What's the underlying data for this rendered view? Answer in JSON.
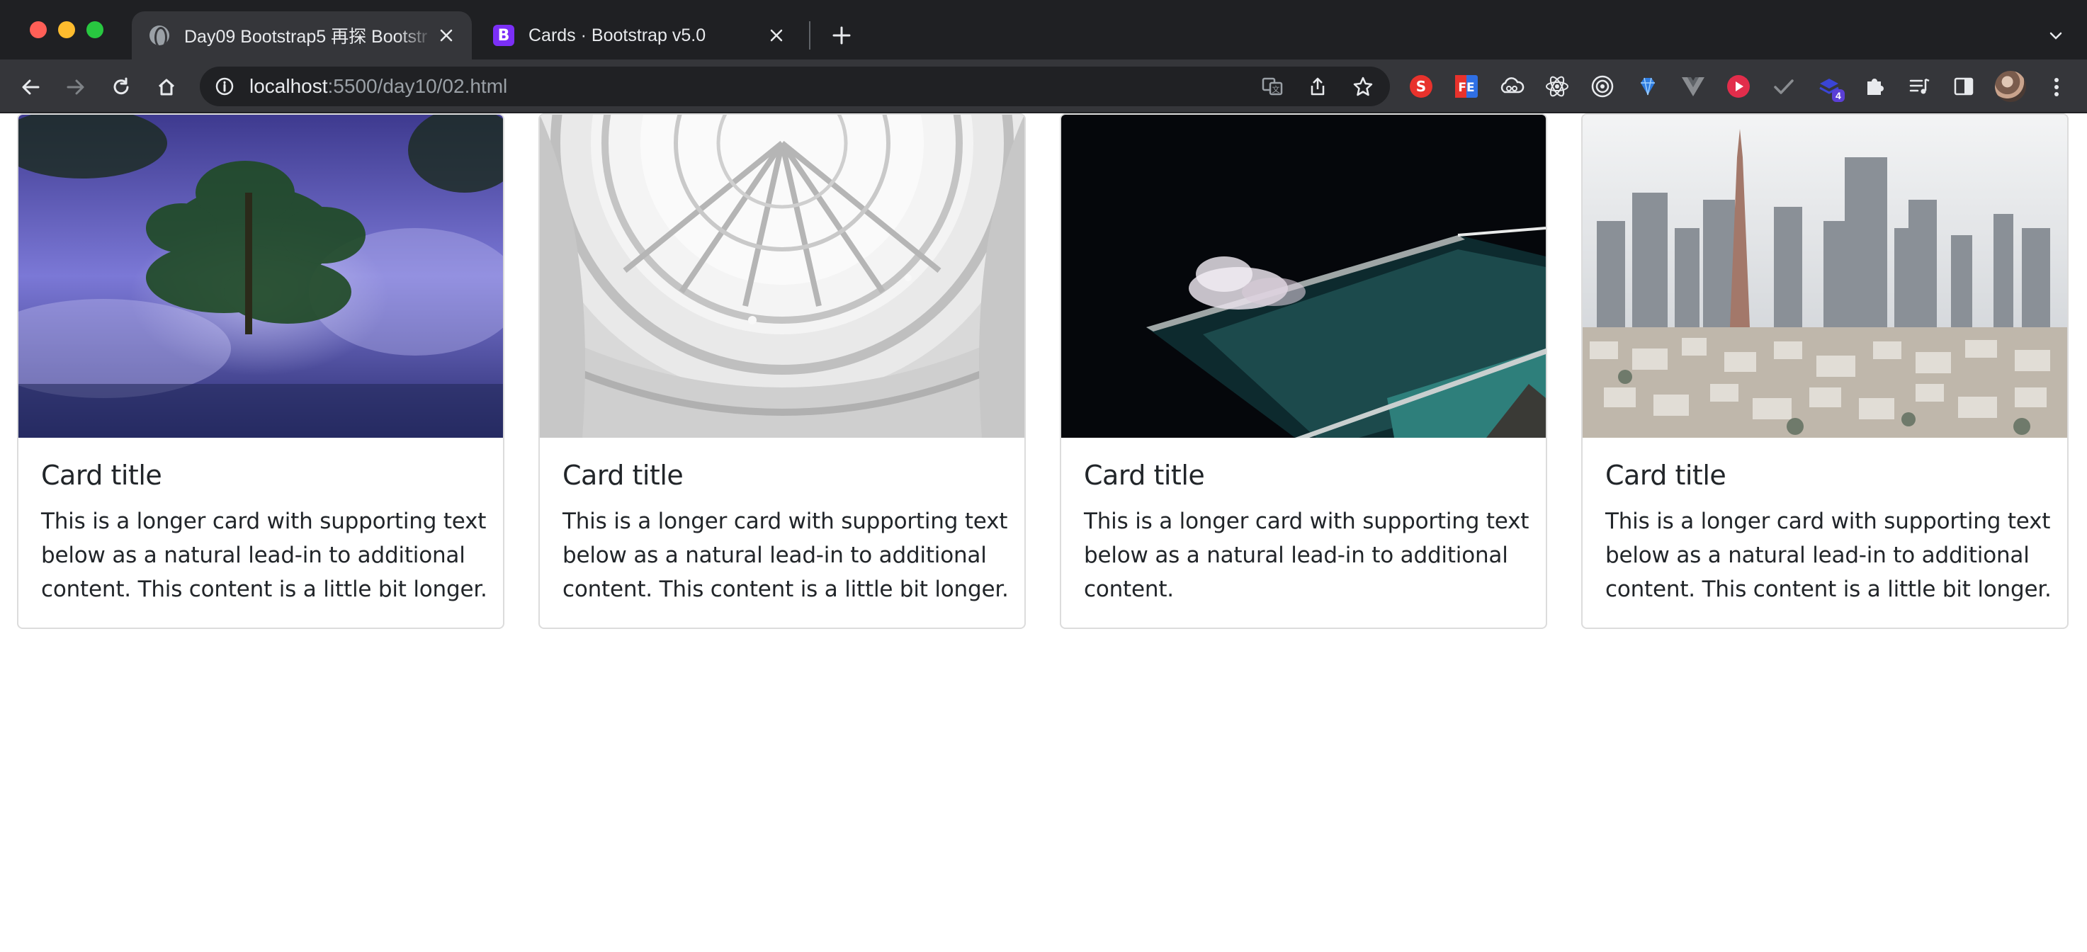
{
  "browser": {
    "tabs": [
      {
        "title": "Day09 Bootstrap5 再探 Bootstr",
        "favicon": "globe-icon",
        "active": true
      },
      {
        "title": "Cards · Bootstrap v5.0",
        "favicon": "bootstrap-logo-icon",
        "favicon_text": "B",
        "active": false
      }
    ],
    "address": {
      "host": "localhost",
      "rest": ":5500/day10/02.html"
    },
    "extension_badge": "4"
  },
  "cards": [
    {
      "title": "Card title",
      "text": "This is a longer card with supporting text below as a natural lead-in to additional content. This content is a little bit longer.",
      "image": "tree-reflection-photo"
    },
    {
      "title": "Card title",
      "text": "This is a longer card with supporting text below as a natural lead-in to additional content. This content is a little bit longer.",
      "image": "museum-rotunda-photo"
    },
    {
      "title": "Card title",
      "text": "This is a longer card with supporting text below as a natural lead-in to additional content.",
      "image": "ocean-pool-photo"
    },
    {
      "title": "Card title",
      "text": "This is a longer card with supporting text below as a natural lead-in to additional content. This content is a little bit longer.",
      "image": "city-skyline-photo"
    }
  ],
  "colors": {
    "chrome_dark": "#1f2023",
    "toolbar": "#35363a",
    "text": "#212529",
    "card_border": "#dcdcdc"
  }
}
